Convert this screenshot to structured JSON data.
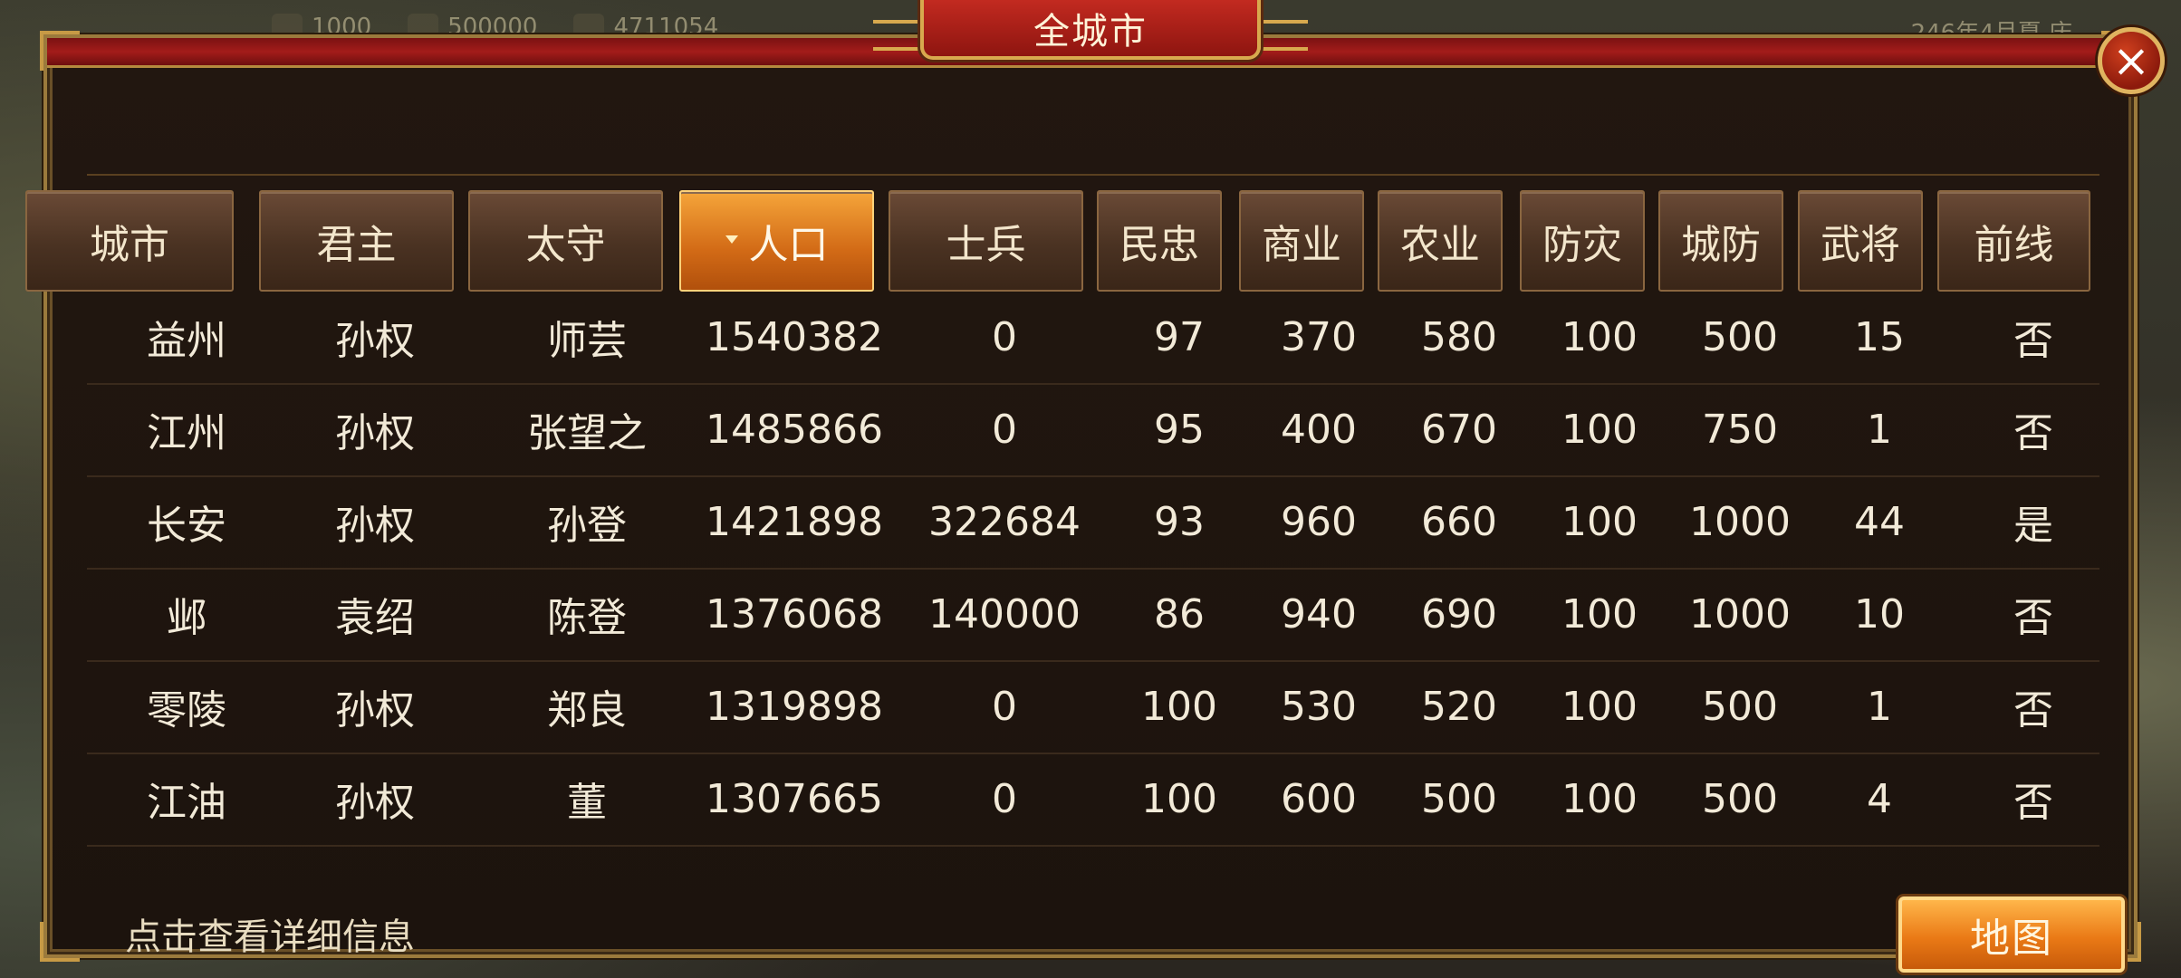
{
  "title": "全城市",
  "close_icon": "close-icon",
  "hud": {
    "items": [
      "1000",
      "500000",
      "4711054"
    ],
    "date_text": "246年4月夏 庆"
  },
  "table": {
    "columns": [
      "城市",
      "君主",
      "太守",
      "人口",
      "士兵",
      "民忠",
      "商业",
      "农业",
      "防灾",
      "城防",
      "武将",
      "前线"
    ],
    "sorted_column": "人口",
    "rows": [
      [
        "益州",
        "孙权",
        "师芸",
        "1540382",
        "0",
        "97",
        "370",
        "580",
        "100",
        "500",
        "15",
        "否"
      ],
      [
        "江州",
        "孙权",
        "张望之",
        "1485866",
        "0",
        "95",
        "400",
        "670",
        "100",
        "750",
        "1",
        "否"
      ],
      [
        "长安",
        "孙权",
        "孙登",
        "1421898",
        "322684",
        "93",
        "960",
        "660",
        "100",
        "1000",
        "44",
        "是"
      ],
      [
        "邺",
        "袁绍",
        "陈登",
        "1376068",
        "140000",
        "86",
        "940",
        "690",
        "100",
        "1000",
        "10",
        "否"
      ],
      [
        "零陵",
        "孙权",
        "郑良",
        "1319898",
        "0",
        "100",
        "530",
        "520",
        "100",
        "500",
        "1",
        "否"
      ],
      [
        "江油",
        "孙权",
        "董",
        "1307665",
        "0",
        "100",
        "600",
        "500",
        "100",
        "500",
        "4",
        "否"
      ]
    ]
  },
  "footer": {
    "hint": "点击查看详细信息",
    "map_button": "地图"
  },
  "colors": {
    "title_red": "#c22a20",
    "gold_border": "#d8a94e",
    "active_header": "#ea7a16",
    "panel_bg": "#1c130d"
  }
}
